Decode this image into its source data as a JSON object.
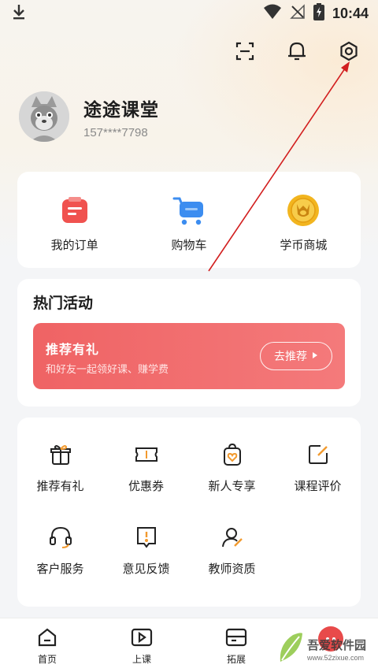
{
  "status_bar": {
    "time": "10:44",
    "icons": [
      "download-icon",
      "wifi-icon",
      "no-signal-icon",
      "battery-charging-icon"
    ]
  },
  "top_actions": {
    "icons": [
      "scan-icon",
      "bell-icon",
      "settings-icon"
    ]
  },
  "profile": {
    "name": "途途课堂",
    "phone": "157****7798"
  },
  "quick_links": [
    {
      "label": "我的订单",
      "icon": "order-icon",
      "color": "#f0524f"
    },
    {
      "label": "购物车",
      "icon": "cart-icon",
      "color": "#3c8df0"
    },
    {
      "label": "学币商城",
      "icon": "coin-mall-icon",
      "color": "#f2b51f"
    }
  ],
  "activity": {
    "title": "热门活动",
    "banner": {
      "title": "推荐有礼",
      "subtitle": "和好友一起领好课、赚学费",
      "button": "去推荐"
    }
  },
  "menu": [
    {
      "label": "推荐有礼",
      "icon": "gift-icon"
    },
    {
      "label": "优惠券",
      "icon": "coupon-icon"
    },
    {
      "label": "新人专享",
      "icon": "newcomer-bag-icon"
    },
    {
      "label": "课程评价",
      "icon": "review-edit-icon"
    },
    {
      "label": "客户服务",
      "icon": "headset-icon"
    },
    {
      "label": "意见反馈",
      "icon": "feedback-icon"
    },
    {
      "label": "教师资质",
      "icon": "teacher-icon"
    }
  ],
  "bottom_nav": [
    {
      "label": "首页",
      "icon": "home-icon"
    },
    {
      "label": "上课",
      "icon": "play-icon"
    },
    {
      "label": "拓展",
      "icon": "expand-icon"
    },
    {
      "label": "",
      "icon": "profile-tab-icon"
    }
  ],
  "watermark": {
    "text": "吾爱软件园",
    "url": "www.52zixue.com"
  },
  "colors": {
    "accent": "#ee6b6b",
    "annotation": "#d21f1f",
    "orange_accent": "#f29a2e"
  }
}
